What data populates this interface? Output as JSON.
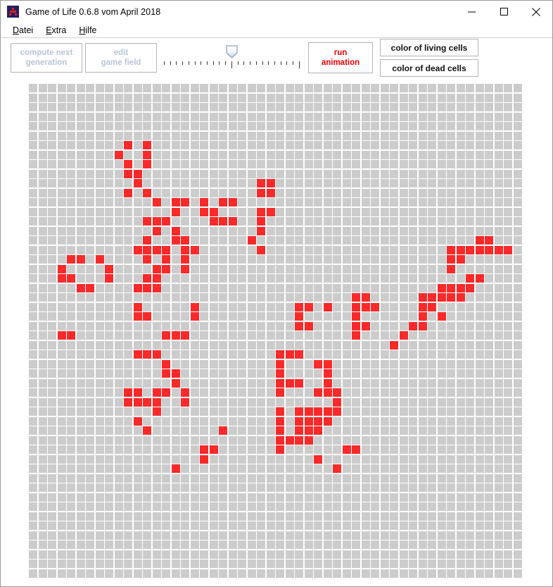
{
  "window": {
    "title": "Game of Life 0.6.8 vom April 2018",
    "icon": "app-icon",
    "controls": {
      "minimize": "minimize-icon",
      "maximize": "maximize-icon",
      "close": "close-icon"
    }
  },
  "menu": {
    "items": [
      {
        "label": "Datei",
        "accel": "D"
      },
      {
        "label": "Extra",
        "accel": "E"
      },
      {
        "label": "Hilfe",
        "accel": "H"
      }
    ]
  },
  "toolbar": {
    "compute_button": "compute next\ngeneration",
    "compute_button_enabled": false,
    "edit_button": "edit\ngame field",
    "edit_button_enabled": false,
    "run_button": "run\nanimation",
    "color_living_button": "color of living cells",
    "color_dead_button": "color of dead cells",
    "speed_slider": {
      "name": "speed-slider",
      "ticks": 23,
      "value_index": 11
    }
  },
  "colors": {
    "living_cell": "#fa2a2a",
    "dead_cell": "#cccccc",
    "background": "#ffffff",
    "disabled_text": "#b9c4d8",
    "run_text": "#f00000",
    "border": "#b4b4b4"
  },
  "grid": {
    "columns": 52,
    "rows": 52,
    "cell_size": 12,
    "cell_pitch": 13.5,
    "live_cells": [
      [
        10,
        6
      ],
      [
        12,
        6
      ],
      [
        9,
        7
      ],
      [
        12,
        7
      ],
      [
        10,
        8
      ],
      [
        12,
        8
      ],
      [
        10,
        9
      ],
      [
        11,
        9
      ],
      [
        11,
        10
      ],
      [
        24,
        10
      ],
      [
        25,
        10
      ],
      [
        10,
        11
      ],
      [
        12,
        11
      ],
      [
        24,
        11
      ],
      [
        25,
        11
      ],
      [
        13,
        12
      ],
      [
        15,
        12
      ],
      [
        16,
        12
      ],
      [
        18,
        12
      ],
      [
        20,
        12
      ],
      [
        21,
        12
      ],
      [
        15,
        13
      ],
      [
        18,
        13
      ],
      [
        19,
        13
      ],
      [
        24,
        13
      ],
      [
        25,
        13
      ],
      [
        12,
        14
      ],
      [
        13,
        14
      ],
      [
        14,
        14
      ],
      [
        19,
        14
      ],
      [
        20,
        14
      ],
      [
        21,
        14
      ],
      [
        24,
        14
      ],
      [
        13,
        15
      ],
      [
        15,
        15
      ],
      [
        24,
        15
      ],
      [
        12,
        16
      ],
      [
        15,
        16
      ],
      [
        16,
        16
      ],
      [
        23,
        16
      ],
      [
        47,
        16
      ],
      [
        48,
        16
      ],
      [
        11,
        17
      ],
      [
        13,
        17
      ],
      [
        14,
        17
      ],
      [
        16,
        17
      ],
      [
        17,
        17
      ],
      [
        24,
        17
      ],
      [
        44,
        17
      ],
      [
        45,
        17
      ],
      [
        46,
        17
      ],
      [
        47,
        17
      ],
      [
        48,
        17
      ],
      [
        49,
        17
      ],
      [
        50,
        17
      ],
      [
        12,
        17
      ],
      [
        4,
        18
      ],
      [
        5,
        18
      ],
      [
        7,
        18
      ],
      [
        12,
        18
      ],
      [
        14,
        18
      ],
      [
        16,
        18
      ],
      [
        44,
        18
      ],
      [
        45,
        18
      ],
      [
        3,
        19
      ],
      [
        8,
        19
      ],
      [
        13,
        19
      ],
      [
        14,
        19
      ],
      [
        16,
        19
      ],
      [
        44,
        19
      ],
      [
        3,
        20
      ],
      [
        8,
        20
      ],
      [
        12,
        20
      ],
      [
        13,
        20
      ],
      [
        46,
        20
      ],
      [
        47,
        20
      ],
      [
        4,
        20
      ],
      [
        5,
        21
      ],
      [
        6,
        21
      ],
      [
        12,
        21
      ],
      [
        13,
        21
      ],
      [
        43,
        21
      ],
      [
        44,
        21
      ],
      [
        45,
        21
      ],
      [
        46,
        21
      ],
      [
        11,
        21
      ],
      [
        34,
        22
      ],
      [
        35,
        22
      ],
      [
        41,
        22
      ],
      [
        42,
        22
      ],
      [
        43,
        22
      ],
      [
        44,
        22
      ],
      [
        45,
        22
      ],
      [
        11,
        23
      ],
      [
        17,
        23
      ],
      [
        31,
        23
      ],
      [
        34,
        23
      ],
      [
        35,
        23
      ],
      [
        36,
        23
      ],
      [
        41,
        23
      ],
      [
        42,
        23
      ],
      [
        28,
        23
      ],
      [
        29,
        23
      ],
      [
        17,
        24
      ],
      [
        28,
        24
      ],
      [
        34,
        24
      ],
      [
        41,
        24
      ],
      [
        43,
        24
      ],
      [
        11,
        24
      ],
      [
        12,
        24
      ],
      [
        28,
        25
      ],
      [
        29,
        25
      ],
      [
        34,
        25
      ],
      [
        35,
        25
      ],
      [
        41,
        25
      ],
      [
        40,
        25
      ],
      [
        3,
        26
      ],
      [
        4,
        26
      ],
      [
        14,
        26
      ],
      [
        15,
        26
      ],
      [
        16,
        26
      ],
      [
        34,
        26
      ],
      [
        39,
        26
      ],
      [
        38,
        27
      ],
      [
        11,
        28
      ],
      [
        12,
        28
      ],
      [
        13,
        28
      ],
      [
        26,
        28
      ],
      [
        27,
        28
      ],
      [
        28,
        28
      ],
      [
        14,
        29
      ],
      [
        26,
        29
      ],
      [
        30,
        29
      ],
      [
        31,
        29
      ],
      [
        14,
        30
      ],
      [
        15,
        30
      ],
      [
        26,
        30
      ],
      [
        31,
        30
      ],
      [
        15,
        31
      ],
      [
        26,
        31
      ],
      [
        27,
        31
      ],
      [
        28,
        31
      ],
      [
        31,
        31
      ],
      [
        10,
        32
      ],
      [
        11,
        32
      ],
      [
        13,
        32
      ],
      [
        14,
        32
      ],
      [
        16,
        32
      ],
      [
        26,
        32
      ],
      [
        30,
        32
      ],
      [
        31,
        32
      ],
      [
        32,
        32
      ],
      [
        10,
        33
      ],
      [
        13,
        33
      ],
      [
        16,
        33
      ],
      [
        32,
        33
      ],
      [
        11,
        33
      ],
      [
        12,
        33
      ],
      [
        13,
        34
      ],
      [
        26,
        34
      ],
      [
        28,
        34
      ],
      [
        29,
        34
      ],
      [
        30,
        34
      ],
      [
        31,
        34
      ],
      [
        32,
        34
      ],
      [
        11,
        35
      ],
      [
        26,
        35
      ],
      [
        28,
        35
      ],
      [
        29,
        35
      ],
      [
        30,
        35
      ],
      [
        31,
        35
      ],
      [
        12,
        36
      ],
      [
        20,
        36
      ],
      [
        26,
        36
      ],
      [
        28,
        36
      ],
      [
        29,
        36
      ],
      [
        30,
        36
      ],
      [
        26,
        37
      ],
      [
        27,
        37
      ],
      [
        28,
        37
      ],
      [
        29,
        37
      ],
      [
        18,
        38
      ],
      [
        19,
        38
      ],
      [
        26,
        38
      ],
      [
        33,
        38
      ],
      [
        34,
        38
      ],
      [
        18,
        39
      ],
      [
        30,
        39
      ],
      [
        15,
        40
      ],
      [
        32,
        40
      ]
    ]
  }
}
